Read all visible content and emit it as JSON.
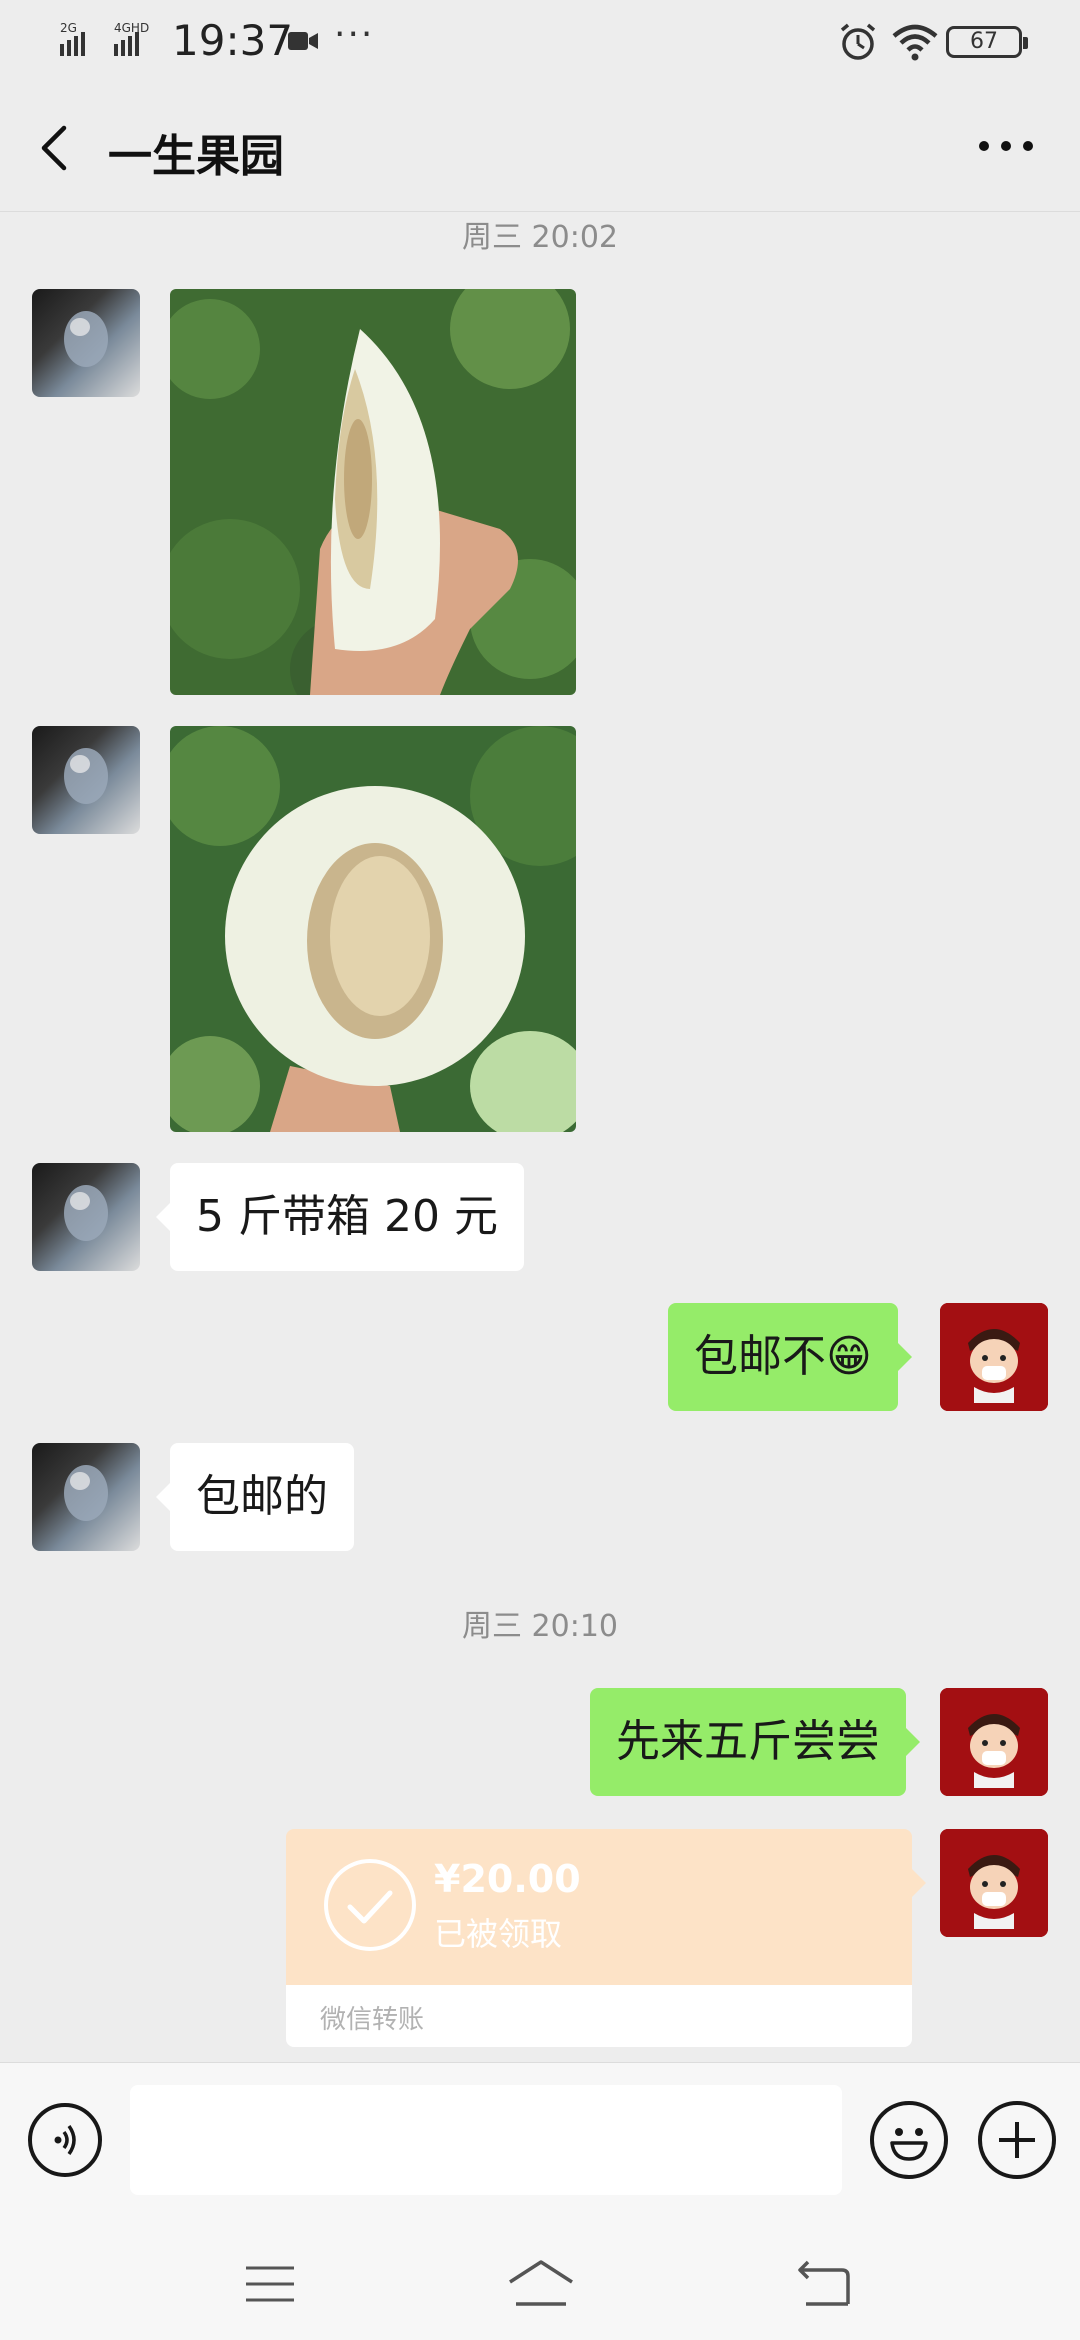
{
  "status_bar": {
    "network": "2G 4G HD",
    "time": "19:37",
    "more": "···",
    "battery": "67"
  },
  "header": {
    "title": "一生果园"
  },
  "messages": {
    "timestamp1": "周三 20:02",
    "msg_price": "5 斤带箱 20 元",
    "msg_shipping_q": "包邮不😁",
    "msg_shipping_a": "包邮的",
    "timestamp2": "周三 20:10",
    "msg_order": "先来五斤尝尝"
  },
  "transfer": {
    "amount": "¥20.00",
    "status": "已被领取",
    "label": "微信转账"
  },
  "colors": {
    "background": "#ededed",
    "sent_bubble": "#95ec69",
    "received_bubble": "#ffffff",
    "transfer_card": "#fde3c7"
  }
}
